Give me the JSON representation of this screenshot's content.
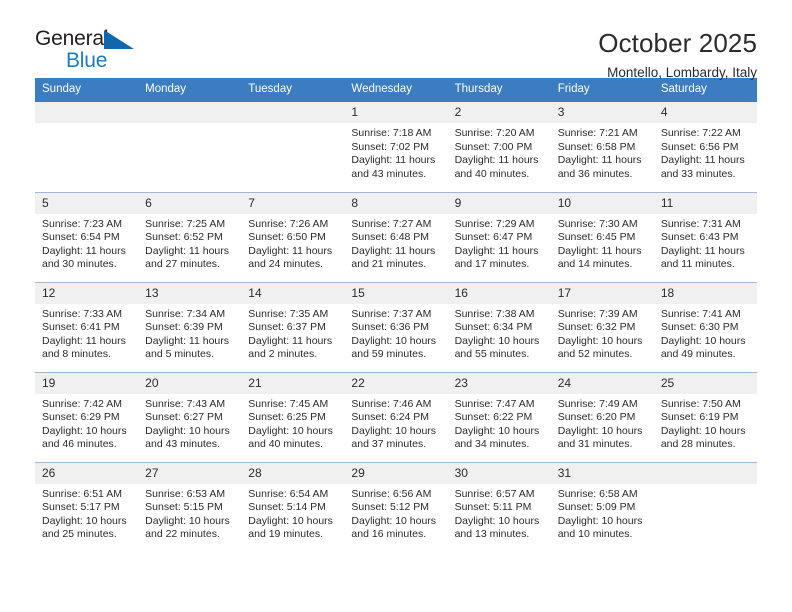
{
  "brand": {
    "name_top": "General",
    "name_bottom": "Blue",
    "triangle_color": "#1166ad",
    "blue_color": "#1a7dc4"
  },
  "header": {
    "title": "October 2025",
    "subtitle": "Montello, Lombardy, Italy"
  },
  "theme": {
    "header_bg": "#3b7dc0",
    "header_text": "#ffffff",
    "daynum_bg": "#f0f0f0",
    "row_divider": "#9fb7cf",
    "body_text": "#2b2b2b"
  },
  "weekday_headers": [
    "Sunday",
    "Monday",
    "Tuesday",
    "Wednesday",
    "Thursday",
    "Friday",
    "Saturday"
  ],
  "labels": {
    "sunrise_prefix": "Sunrise:",
    "sunset_prefix": "Sunset:",
    "daylight_prefix": "Daylight:"
  },
  "weeks": [
    [
      {
        "day": "",
        "lines": []
      },
      {
        "day": "",
        "lines": []
      },
      {
        "day": "",
        "lines": []
      },
      {
        "day": "1",
        "lines": [
          "Sunrise: 7:18 AM",
          "Sunset: 7:02 PM",
          "Daylight: 11 hours",
          "and 43 minutes."
        ]
      },
      {
        "day": "2",
        "lines": [
          "Sunrise: 7:20 AM",
          "Sunset: 7:00 PM",
          "Daylight: 11 hours",
          "and 40 minutes."
        ]
      },
      {
        "day": "3",
        "lines": [
          "Sunrise: 7:21 AM",
          "Sunset: 6:58 PM",
          "Daylight: 11 hours",
          "and 36 minutes."
        ]
      },
      {
        "day": "4",
        "lines": [
          "Sunrise: 7:22 AM",
          "Sunset: 6:56 PM",
          "Daylight: 11 hours",
          "and 33 minutes."
        ]
      }
    ],
    [
      {
        "day": "5",
        "lines": [
          "Sunrise: 7:23 AM",
          "Sunset: 6:54 PM",
          "Daylight: 11 hours",
          "and 30 minutes."
        ]
      },
      {
        "day": "6",
        "lines": [
          "Sunrise: 7:25 AM",
          "Sunset: 6:52 PM",
          "Daylight: 11 hours",
          "and 27 minutes."
        ]
      },
      {
        "day": "7",
        "lines": [
          "Sunrise: 7:26 AM",
          "Sunset: 6:50 PM",
          "Daylight: 11 hours",
          "and 24 minutes."
        ]
      },
      {
        "day": "8",
        "lines": [
          "Sunrise: 7:27 AM",
          "Sunset: 6:48 PM",
          "Daylight: 11 hours",
          "and 21 minutes."
        ]
      },
      {
        "day": "9",
        "lines": [
          "Sunrise: 7:29 AM",
          "Sunset: 6:47 PM",
          "Daylight: 11 hours",
          "and 17 minutes."
        ]
      },
      {
        "day": "10",
        "lines": [
          "Sunrise: 7:30 AM",
          "Sunset: 6:45 PM",
          "Daylight: 11 hours",
          "and 14 minutes."
        ]
      },
      {
        "day": "11",
        "lines": [
          "Sunrise: 7:31 AM",
          "Sunset: 6:43 PM",
          "Daylight: 11 hours",
          "and 11 minutes."
        ]
      }
    ],
    [
      {
        "day": "12",
        "lines": [
          "Sunrise: 7:33 AM",
          "Sunset: 6:41 PM",
          "Daylight: 11 hours",
          "and 8 minutes."
        ]
      },
      {
        "day": "13",
        "lines": [
          "Sunrise: 7:34 AM",
          "Sunset: 6:39 PM",
          "Daylight: 11 hours",
          "and 5 minutes."
        ]
      },
      {
        "day": "14",
        "lines": [
          "Sunrise: 7:35 AM",
          "Sunset: 6:37 PM",
          "Daylight: 11 hours",
          "and 2 minutes."
        ]
      },
      {
        "day": "15",
        "lines": [
          "Sunrise: 7:37 AM",
          "Sunset: 6:36 PM",
          "Daylight: 10 hours",
          "and 59 minutes."
        ]
      },
      {
        "day": "16",
        "lines": [
          "Sunrise: 7:38 AM",
          "Sunset: 6:34 PM",
          "Daylight: 10 hours",
          "and 55 minutes."
        ]
      },
      {
        "day": "17",
        "lines": [
          "Sunrise: 7:39 AM",
          "Sunset: 6:32 PM",
          "Daylight: 10 hours",
          "and 52 minutes."
        ]
      },
      {
        "day": "18",
        "lines": [
          "Sunrise: 7:41 AM",
          "Sunset: 6:30 PM",
          "Daylight: 10 hours",
          "and 49 minutes."
        ]
      }
    ],
    [
      {
        "day": "19",
        "lines": [
          "Sunrise: 7:42 AM",
          "Sunset: 6:29 PM",
          "Daylight: 10 hours",
          "and 46 minutes."
        ]
      },
      {
        "day": "20",
        "lines": [
          "Sunrise: 7:43 AM",
          "Sunset: 6:27 PM",
          "Daylight: 10 hours",
          "and 43 minutes."
        ]
      },
      {
        "day": "21",
        "lines": [
          "Sunrise: 7:45 AM",
          "Sunset: 6:25 PM",
          "Daylight: 10 hours",
          "and 40 minutes."
        ]
      },
      {
        "day": "22",
        "lines": [
          "Sunrise: 7:46 AM",
          "Sunset: 6:24 PM",
          "Daylight: 10 hours",
          "and 37 minutes."
        ]
      },
      {
        "day": "23",
        "lines": [
          "Sunrise: 7:47 AM",
          "Sunset: 6:22 PM",
          "Daylight: 10 hours",
          "and 34 minutes."
        ]
      },
      {
        "day": "24",
        "lines": [
          "Sunrise: 7:49 AM",
          "Sunset: 6:20 PM",
          "Daylight: 10 hours",
          "and 31 minutes."
        ]
      },
      {
        "day": "25",
        "lines": [
          "Sunrise: 7:50 AM",
          "Sunset: 6:19 PM",
          "Daylight: 10 hours",
          "and 28 minutes."
        ]
      }
    ],
    [
      {
        "day": "26",
        "lines": [
          "Sunrise: 6:51 AM",
          "Sunset: 5:17 PM",
          "Daylight: 10 hours",
          "and 25 minutes."
        ]
      },
      {
        "day": "27",
        "lines": [
          "Sunrise: 6:53 AM",
          "Sunset: 5:15 PM",
          "Daylight: 10 hours",
          "and 22 minutes."
        ]
      },
      {
        "day": "28",
        "lines": [
          "Sunrise: 6:54 AM",
          "Sunset: 5:14 PM",
          "Daylight: 10 hours",
          "and 19 minutes."
        ]
      },
      {
        "day": "29",
        "lines": [
          "Sunrise: 6:56 AM",
          "Sunset: 5:12 PM",
          "Daylight: 10 hours",
          "and 16 minutes."
        ]
      },
      {
        "day": "30",
        "lines": [
          "Sunrise: 6:57 AM",
          "Sunset: 5:11 PM",
          "Daylight: 10 hours",
          "and 13 minutes."
        ]
      },
      {
        "day": "31",
        "lines": [
          "Sunrise: 6:58 AM",
          "Sunset: 5:09 PM",
          "Daylight: 10 hours",
          "and 10 minutes."
        ]
      },
      {
        "day": "",
        "lines": []
      }
    ]
  ]
}
